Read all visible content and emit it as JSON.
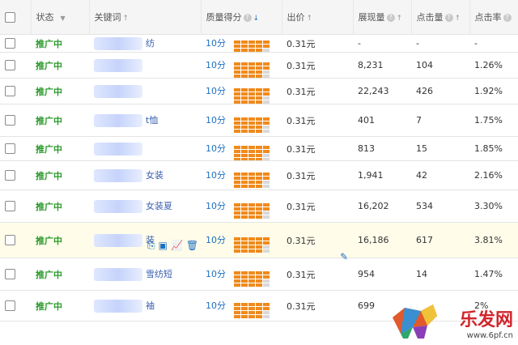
{
  "header": {
    "status": "状态",
    "keyword": "关键词",
    "quality": "质量得分",
    "bid": "出价",
    "impressions": "展现量",
    "clicks": "点击量",
    "ctr": "点击率"
  },
  "rows": [
    {
      "status": "推广中",
      "kw": "纺",
      "qs": "10分",
      "bid": "0.31元",
      "imp": "-",
      "clk": "-",
      "ctr": "-"
    },
    {
      "status": "推广中",
      "kw": "",
      "qs": "10分",
      "bid": "0.31元",
      "imp": "8,231",
      "clk": "104",
      "ctr": "1.26%"
    },
    {
      "status": "推广中",
      "kw": "",
      "qs": "10分",
      "bid": "0.31元",
      "imp": "22,243",
      "clk": "426",
      "ctr": "1.92%"
    },
    {
      "status": "推广中",
      "kw": "t恤",
      "qs": "10分",
      "bid": "0.31元",
      "imp": "401",
      "clk": "7",
      "ctr": "1.75%"
    },
    {
      "status": "推广中",
      "kw": "",
      "qs": "10分",
      "bid": "0.31元",
      "imp": "813",
      "clk": "15",
      "ctr": "1.85%"
    },
    {
      "status": "推广中",
      "kw": "女装",
      "qs": "10分",
      "bid": "0.31元",
      "imp": "1,941",
      "clk": "42",
      "ctr": "2.16%"
    },
    {
      "status": "推广中",
      "kw": "女装夏",
      "qs": "10分",
      "bid": "0.31元",
      "imp": "16,202",
      "clk": "534",
      "ctr": "3.30%"
    },
    {
      "status": "推广中",
      "kw": "装",
      "qs": "10分",
      "bid": "0.31元",
      "imp": "16,186",
      "clk": "617",
      "ctr": "3.81%"
    },
    {
      "status": "推广中",
      "kw": "雪纺短",
      "qs": "10分",
      "bid": "0.31元",
      "imp": "954",
      "clk": "14",
      "ctr": "1.47%"
    },
    {
      "status": "推广中",
      "kw": "袖",
      "qs": "10分",
      "bid": "0.31元",
      "imp": "699",
      "clk": "",
      "ctr": "2%"
    }
  ],
  "watermark": {
    "title": "乐发网",
    "url": "www.6pf.cn"
  },
  "colors": {
    "status": "#2b9a2b",
    "link": "#1f6fbf",
    "bar_on": "#f08a1c",
    "bar_off": "#d9d9d9"
  }
}
